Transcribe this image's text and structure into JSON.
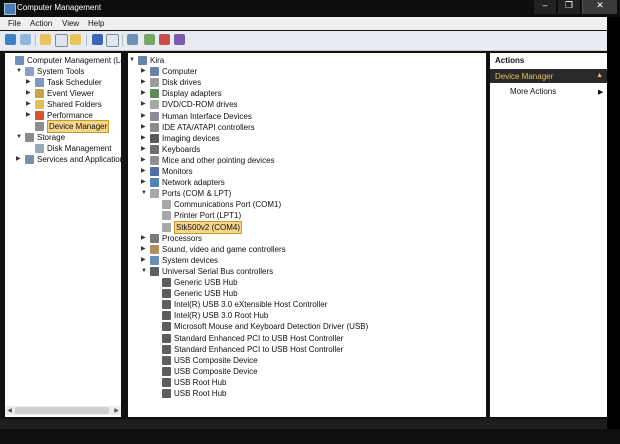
{
  "window": {
    "title": "Computer Management",
    "min_glyph": "‒",
    "max_glyph": "❐",
    "close_glyph": "✕"
  },
  "menu": [
    "File",
    "Action",
    "View",
    "Help"
  ],
  "left_tree": [
    {
      "label": "Computer Management (Local",
      "icon": "computer-management-icon",
      "level": 0,
      "twisty": ""
    },
    {
      "label": "System Tools",
      "icon": "system-tools-icon",
      "level": 1,
      "twisty": "▼"
    },
    {
      "label": "Task Scheduler",
      "icon": "task-scheduler-icon",
      "level": 2,
      "twisty": "▶"
    },
    {
      "label": "Event Viewer",
      "icon": "event-viewer-icon",
      "level": 2,
      "twisty": "▶"
    },
    {
      "label": "Shared Folders",
      "icon": "shared-folders-icon",
      "level": 2,
      "twisty": "▶"
    },
    {
      "label": "Performance",
      "icon": "performance-icon",
      "level": 2,
      "twisty": "▶"
    },
    {
      "label": "Device Manager",
      "icon": "device-manager-icon",
      "level": 2,
      "twisty": "",
      "selected": true
    },
    {
      "label": "Storage",
      "icon": "storage-icon",
      "level": 1,
      "twisty": "▼"
    },
    {
      "label": "Disk Management",
      "icon": "disk-management-icon",
      "level": 2,
      "twisty": ""
    },
    {
      "label": "Services and Applications",
      "icon": "services-icon",
      "level": 1,
      "twisty": "▶"
    }
  ],
  "device_tree": [
    {
      "label": "Kira",
      "icon": "computer-icon",
      "level": 0,
      "twisty": "▼"
    },
    {
      "label": "Computer",
      "icon": "computer-icon",
      "level": 1,
      "twisty": "▶"
    },
    {
      "label": "Disk drives",
      "icon": "disk-drive-icon",
      "level": 1,
      "twisty": "▶"
    },
    {
      "label": "Display adapters",
      "icon": "display-adapter-icon",
      "level": 1,
      "twisty": "▶"
    },
    {
      "label": "DVD/CD-ROM drives",
      "icon": "dvd-drive-icon",
      "level": 1,
      "twisty": "▶"
    },
    {
      "label": "Human Interface Devices",
      "icon": "hid-icon",
      "level": 1,
      "twisty": "▶"
    },
    {
      "label": "IDE ATA/ATAPI controllers",
      "icon": "ide-controller-icon",
      "level": 1,
      "twisty": "▶"
    },
    {
      "label": "Imaging devices",
      "icon": "camera-icon",
      "level": 1,
      "twisty": "▶"
    },
    {
      "label": "Keyboards",
      "icon": "keyboard-icon",
      "level": 1,
      "twisty": "▶"
    },
    {
      "label": "Mice and other pointing devices",
      "icon": "mouse-icon",
      "level": 1,
      "twisty": "▶"
    },
    {
      "label": "Monitors",
      "icon": "monitor-icon",
      "level": 1,
      "twisty": "▶"
    },
    {
      "label": "Network adapters",
      "icon": "network-adapter-icon",
      "level": 1,
      "twisty": "▶"
    },
    {
      "label": "Ports (COM & LPT)",
      "icon": "port-icon",
      "level": 1,
      "twisty": "▼"
    },
    {
      "label": "Communications Port (COM1)",
      "icon": "port-icon",
      "level": 2,
      "twisty": ""
    },
    {
      "label": "Printer Port (LPT1)",
      "icon": "port-icon",
      "level": 2,
      "twisty": ""
    },
    {
      "label": "Stk500v2 (COM4)",
      "icon": "port-icon",
      "level": 2,
      "twisty": "",
      "selected": true
    },
    {
      "label": "Processors",
      "icon": "processor-icon",
      "level": 1,
      "twisty": "▶"
    },
    {
      "label": "Sound, video and game controllers",
      "icon": "sound-icon",
      "level": 1,
      "twisty": "▶"
    },
    {
      "label": "System devices",
      "icon": "system-device-icon",
      "level": 1,
      "twisty": "▶"
    },
    {
      "label": "Universal Serial Bus controllers",
      "icon": "usb-icon",
      "level": 1,
      "twisty": "▼"
    },
    {
      "label": "Generic USB Hub",
      "icon": "usb-icon",
      "level": 2,
      "twisty": ""
    },
    {
      "label": "Generic USB Hub",
      "icon": "usb-icon",
      "level": 2,
      "twisty": ""
    },
    {
      "label": "Intel(R) USB 3.0 eXtensible Host Controller",
      "icon": "usb-icon",
      "level": 2,
      "twisty": ""
    },
    {
      "label": "Intel(R) USB 3.0 Root Hub",
      "icon": "usb-icon",
      "level": 2,
      "twisty": ""
    },
    {
      "label": "Microsoft Mouse and Keyboard Detection Driver (USB)",
      "icon": "usb-icon",
      "level": 2,
      "twisty": ""
    },
    {
      "label": "Standard Enhanced PCI to USB Host Controller",
      "icon": "usb-icon",
      "level": 2,
      "twisty": ""
    },
    {
      "label": "Standard Enhanced PCI to USB Host Controller",
      "icon": "usb-icon",
      "level": 2,
      "twisty": ""
    },
    {
      "label": "USB Composite Device",
      "icon": "usb-icon",
      "level": 2,
      "twisty": ""
    },
    {
      "label": "USB Composite Device",
      "icon": "usb-icon",
      "level": 2,
      "twisty": ""
    },
    {
      "label": "USB Root Hub",
      "icon": "usb-icon",
      "level": 2,
      "twisty": ""
    },
    {
      "label": "USB Root Hub",
      "icon": "usb-icon",
      "level": 2,
      "twisty": ""
    }
  ],
  "actions": {
    "header": "Actions",
    "section": "Device Manager",
    "collapse_glyph": "▲",
    "more": "More Actions",
    "more_glyph": "▶"
  },
  "scroll": {
    "left_glyph": "◀",
    "right_glyph": "▶"
  },
  "colors": {
    "selection": "#f7d58a",
    "titlebar": "#0e0e0e",
    "actions_section_text": "#e2c066"
  }
}
